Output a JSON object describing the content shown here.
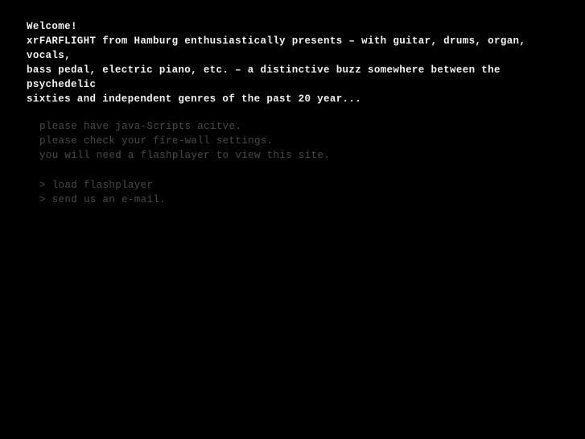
{
  "page": {
    "background_color": "#000000",
    "bright_text_color": "#f2f2f2",
    "dim_text_color": "#4a4a4a"
  },
  "intro": {
    "heading": "Welcome!",
    "lines": [
      "xrFARFLIGHT from Hamburg enthusiastically presents – with guitar, drums, organ, vocals,",
      "bass pedal, electric piano, etc. – a distinctive buzz somewhere between the psychedelic",
      "sixties and independent genres of the past 20 year..."
    ],
    "line1": "xrFARFLIGHT from Hamburg enthusiastically presents – with guitar, drums, organ, vocals,",
    "line2": "bass pedal, electric piano, etc. – a distinctive buzz somewhere between the psychedelic",
    "line3": "sixties and independent genres of the past 20 year..."
  },
  "notices": {
    "line1": "please have java-Scripts acitve.",
    "line2": "please check your fire-wall settings.",
    "line3": "you will need a flashplayer to view this site."
  },
  "links": {
    "load_flashplayer": "> load flashplayer",
    "send_email": "> send us an e-mail."
  }
}
